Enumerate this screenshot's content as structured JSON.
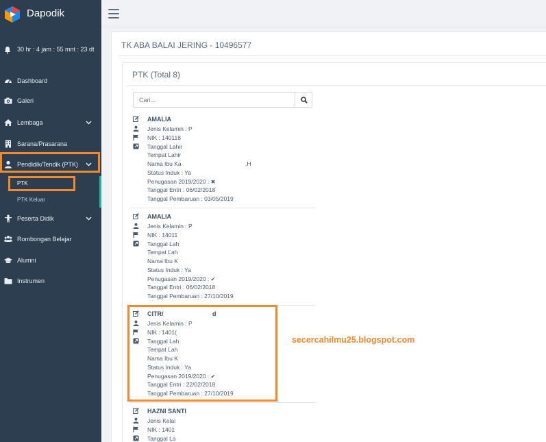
{
  "app": {
    "name": "Dapodik"
  },
  "notification": {
    "text": "30 hr : 4 jam : 55 mnt : 23 dt"
  },
  "sidebar": {
    "items": [
      {
        "label": "Dashboard"
      },
      {
        "label": "Galeri"
      },
      {
        "label": "Lembaga"
      },
      {
        "label": "Sarana/Prasarana"
      },
      {
        "label": "Pendidik/Tendik (PTK)"
      },
      {
        "label": "Peserta Didik"
      },
      {
        "label": "Rombongan Belajar"
      },
      {
        "label": "Alumni"
      },
      {
        "label": "Instrumen"
      }
    ],
    "subitems": [
      {
        "label": "PTK"
      },
      {
        "label": "PTK Keluar"
      }
    ]
  },
  "page": {
    "school": "TK ABA BALAI JERING - 10496577",
    "box_title": "PTK (Total 8)",
    "search_placeholder": "Cari..."
  },
  "records": [
    {
      "name": "AMALIA",
      "jenis_kelamin": "Jenis Kelamin : P",
      "nik": "NIK : 140118",
      "tanggal_lahir": "Tanggal Lahir",
      "tempat_lahir": "Tempat Lahir",
      "nama_ibu": "Nama Ibu Ka",
      "nama_ibu_tail": ",H",
      "status_induk": "Status Induk : Ya",
      "penugasan": "Penugasan 2019/2020 :",
      "penugasan_mark": "✖",
      "tanggal_entri": "Tanggal Entri : 06/02/2018",
      "tanggal_pembaruan": "Tanggal Pembaruan : 03/05/2019"
    },
    {
      "name": "AMALIA",
      "jenis_kelamin": "Jenis Kelamin : P",
      "nik": "NIK : 14011",
      "tanggal_lahir": "Tanggal Lah",
      "tempat_lahir": "Tempat Lah",
      "nama_ibu": "Nama Ibu K",
      "nama_ibu_tail": "",
      "status_induk": "Status Induk : Ya",
      "penugasan": "Penugasan 2019/2020 :",
      "penugasan_mark": "✔",
      "tanggal_entri": "Tanggal Entri : 06/02/2018",
      "tanggal_pembaruan": "Tanggal Pembaruan : 27/10/2019"
    },
    {
      "name": "CITR/",
      "name_tail": "d",
      "jenis_kelamin": "Jenis Kelamin : P",
      "nik": "NIK : 1401(",
      "tanggal_lahir": "Tanggal Lah",
      "tempat_lahir": "Tempat Lah",
      "nama_ibu": "Nama Ibu K",
      "nama_ibu_tail": "",
      "status_induk": "Status Induk : Ya",
      "penugasan": "Penugasan 2019/2020 :",
      "penugasan_mark": "✔",
      "tanggal_entri": "Tanggal Entri : 22/02/2018",
      "tanggal_pembaruan": "Tanggal Pembaruan : 27/10/2019"
    },
    {
      "name": "HAZNI SANTI",
      "jenis_kelamin": "Jenis Kelai",
      "nik": "NIK : 1401",
      "tanggal_lahir": "Tanggal La"
    }
  ],
  "watermark": {
    "text": "secercahilmu25.blogspot.com"
  },
  "colors": {
    "sidebar": "#2c3e50",
    "highlight": "#f58a2c",
    "active": "#1abc9c"
  }
}
